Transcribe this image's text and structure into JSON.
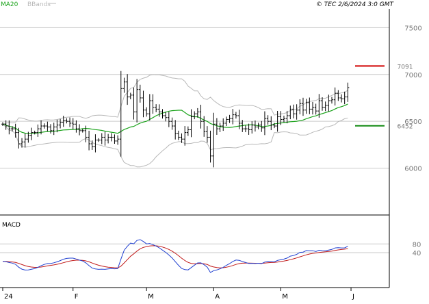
{
  "header": {
    "legend_ma": "MA20",
    "legend_bb": "BBands",
    "copyright": "© TEC 2/6/2024 3:0 GMT"
  },
  "colors": {
    "price_bar": "#000000",
    "ma20": "#1aa31a",
    "bbands": "#b8b8b8",
    "macd_line": "#1f3fd0",
    "signal_line": "#c01818",
    "resistance": "#d00000",
    "support": "#138a13",
    "grid": "#c9c9c9",
    "axis": "#000000",
    "tick_text": "#777777"
  },
  "chart_data": [
    {
      "type": "ohlc",
      "title": "",
      "legend": [
        "MA20",
        "BBands"
      ],
      "y_ticks": [
        {
          "value": 7500,
          "label": "7500"
        },
        {
          "value": 7000,
          "label": "7000"
        },
        {
          "value": 6500,
          "label": "6500"
        },
        {
          "value": 6000,
          "label": "6000"
        }
      ],
      "ylim": [
        5500,
        7700
      ],
      "x_labels": [
        "24",
        "F",
        "M",
        "A",
        "M",
        "J"
      ],
      "x_label_index": [
        0,
        22,
        45,
        66,
        87,
        109
      ],
      "levels": [
        {
          "name": "resistance",
          "value": 7091,
          "label": "7091"
        },
        {
          "name": "support",
          "value": 6452,
          "label": "6452"
        }
      ],
      "close": [
        6470,
        6450,
        6420,
        6420,
        6380,
        6260,
        6280,
        6310,
        6350,
        6380,
        6380,
        6420,
        6450,
        6450,
        6440,
        6400,
        6440,
        6460,
        6490,
        6510,
        6500,
        6480,
        6470,
        6420,
        6400,
        6400,
        6330,
        6260,
        6230,
        6300,
        6300,
        6330,
        6300,
        6330,
        6330,
        6290,
        6310,
        6850,
        6920,
        6760,
        6780,
        6600,
        6840,
        6750,
        6620,
        6580,
        6720,
        6650,
        6630,
        6600,
        6560,
        6540,
        6500,
        6450,
        6370,
        6330,
        6310,
        6380,
        6410,
        6550,
        6580,
        6600,
        6500,
        6390,
        6330,
        6130,
        6470,
        6420,
        6450,
        6480,
        6520,
        6530,
        6570,
        6560,
        6480,
        6420,
        6420,
        6410,
        6460,
        6440,
        6460,
        6430,
        6530,
        6500,
        6460,
        6450,
        6550,
        6520,
        6530,
        6560,
        6630,
        6580,
        6620,
        6690,
        6620,
        6700,
        6630,
        6650,
        6610,
        6720,
        6650,
        6670,
        6720,
        6730,
        6800,
        6750,
        6740,
        6760,
        6860
      ]
    },
    {
      "type": "line",
      "title": "MACD",
      "series": [
        {
          "name": "MACD",
          "role": "macd_line"
        },
        {
          "name": "",
          "role": "signal_line"
        }
      ],
      "y_ticks": [
        {
          "value": 80,
          "label": "80"
        },
        {
          "value": 40,
          "label": "40"
        }
      ],
      "ylim": [
        -120,
        200
      ],
      "fast": 12,
      "slow": 26,
      "signal": 9
    }
  ]
}
